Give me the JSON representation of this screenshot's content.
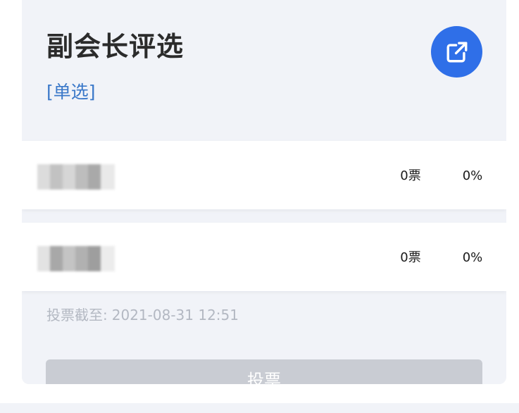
{
  "poll": {
    "title": "副会长评选",
    "type_tag": "[单选]",
    "share_icon": "share-external-icon",
    "accent_color": "#2f6fe8",
    "options": [
      {
        "votes": "0票",
        "percent": "0%"
      },
      {
        "votes": "0票",
        "percent": "0%"
      }
    ],
    "deadline_label": "投票截至:",
    "deadline_value": "2021-08-31 12:51",
    "vote_button_label": "投票"
  }
}
